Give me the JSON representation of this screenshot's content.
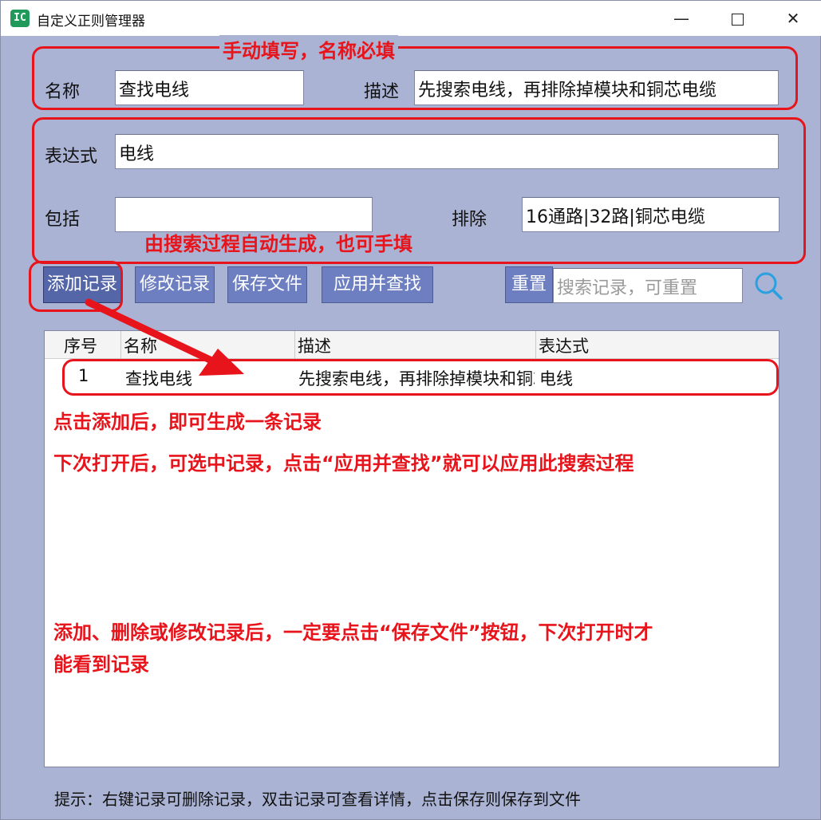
{
  "window": {
    "title": "自定义正则管理器",
    "icon": "app-logo-icon",
    "minimize": "—",
    "close": "✕"
  },
  "form": {
    "name_label": "名称",
    "name_value": "查找电线",
    "desc_label": "描述",
    "desc_value": "先搜索电线，再排除掉模块和铜芯电缆",
    "expr_label": "表达式",
    "expr_value": "电线",
    "include_label": "包括",
    "include_value": "",
    "exclude_label": "排除",
    "exclude_value": "16通路|32路|铜芯电缆"
  },
  "toolbar": {
    "add": "添加记录",
    "modify": "修改记录",
    "save": "保存文件",
    "apply": "应用并查找",
    "reset": "重置",
    "search_placeholder": "搜索记录，可重置"
  },
  "table": {
    "columns": [
      "序号",
      "名称",
      "描述",
      "表达式"
    ],
    "rows": [
      {
        "index": "1",
        "name": "查找电线",
        "desc": "先搜索电线，再排除掉模块和铜芯电缆",
        "expr": "电线"
      }
    ]
  },
  "hint": "提示：右键记录可删除记录，双击记录可查看详情，点击保存则保存到文件",
  "annotations": {
    "manual": "手动填写，名称必填",
    "auto": "由搜索过程自动生成，也可手填",
    "after_add": "点击添加后，即可生成一条记录",
    "next_open": "下次打开后，可选中记录，点击“应用并查找”就可以应用此搜索过程",
    "save_note_1": "添加、删除或修改记录后，一定要点击“保存文件”按钮，下次打开时才",
    "save_note_2": "能看到记录"
  },
  "colors": {
    "annotation": "#e8141b",
    "window_bg": "#aab3d3",
    "button": "#6d7fc0",
    "search_icon": "#2aa0e0"
  }
}
